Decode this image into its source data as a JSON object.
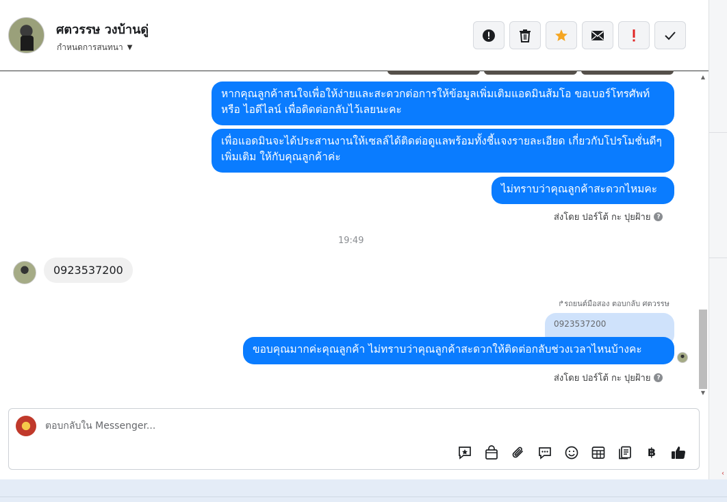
{
  "contact": {
    "name": "ศตวรรษ วงบ้านดู่",
    "assign_label": "กำหนดการสนทนา"
  },
  "toolbar": {
    "buttons": [
      {
        "name": "spam-alert-button",
        "icon": "alert-circle-icon"
      },
      {
        "name": "delete-button",
        "icon": "trash-icon"
      },
      {
        "name": "star-button",
        "icon": "star-icon",
        "color": "#f5a623"
      },
      {
        "name": "mark-unread-button",
        "icon": "envelope-icon"
      },
      {
        "name": "follow-up-button",
        "icon": "exclamation-icon",
        "color": "#e02424"
      },
      {
        "name": "mark-done-button",
        "icon": "check-icon"
      }
    ]
  },
  "messages": {
    "out_1": "หากคุณลูกค้าสนใจเพื่อให้ง่ายและสะดวกต่อการให้ข้อมูลเพิ่มเติมแอดมินส้มโอ ขอเบอร์โทรศัพท์ หรือ ไอดีไลน์ เพื่อติดต่อกลับไว้เลยนะคะ",
    "out_2": "เพื่อแอดมินจะได้ประสานงานให้เซลล์ได้ติดต่อดูแลพร้อมทั้งชี้แจงรายละเอียด เกี่ยวกับโปรโมชั่นดีๆเพิ่มเติม ให้กับคุณลูกค้าค่ะ",
    "out_3": "ไม่ทราบว่าคุณลูกค้าสะดวกไหมคะ",
    "sent_by_1": "ส่งโดย ปอร์โต้ กะ ปุยฝ้าย",
    "time": "19:49",
    "in_1": "0923537200",
    "reply_note": "รถยนต์มือสอง ตอบกลับ ศตวรรษ",
    "quote": "0923537200",
    "out_4": "ขอบคุณมากค่ะคุณลูกค้า ไม่ทราบว่าคุณลูกค้าสะดวกให้ติดต่อกลับช่วงเวลาไหนบ้างคะ",
    "sent_by_2": "ส่งโดย ปอร์โต้ กะ ปุยฝ้าย",
    "help_glyph": "?"
  },
  "composer": {
    "placeholder": "ตอบกลับใน Messenger...",
    "tools": [
      "saved-reply-icon",
      "shopping-bag-icon",
      "attachment-icon",
      "chat-bubble-icon",
      "emoji-icon",
      "table-icon",
      "form-icon",
      "baht-icon",
      "like-icon"
    ],
    "baht_glyph": "฿"
  },
  "colors": {
    "accent": "#0a7cff",
    "incoming": "#f0f0f0",
    "quote": "#cfe2fb"
  }
}
